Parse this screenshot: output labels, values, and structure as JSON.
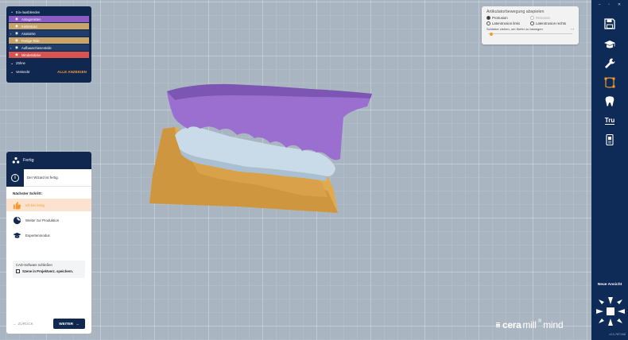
{
  "visibility_panel": {
    "header": "Ein-/ausblenden",
    "rows": [
      {
        "label": "Antagonisten",
        "color": "#8a5cc4",
        "arrow": false
      },
      {
        "label": "Kieferscan",
        "color": "#c9a56a",
        "arrow": false
      },
      {
        "label": "Anatomie",
        "color": "#1f3d6b",
        "arrow": true
      },
      {
        "label": "Fertige Teile",
        "color": "#c9a56a",
        "arrow": false
      },
      {
        "label": "Aufbauschienenteile",
        "color": "#1f3d6b",
        "arrow": true
      },
      {
        "label": "Mindestdicke",
        "color": "#d9534f",
        "arrow": false
      }
    ],
    "teeth_label": "Zähne",
    "hidden_label": "Versteckt",
    "show_all_label": "ALLE ANZEIGEN"
  },
  "articulator": {
    "title": "Artikulatorbewegung abspielen",
    "options": [
      {
        "label": "Protrusion",
        "checked": true,
        "disabled": false
      },
      {
        "label": "Retrusion",
        "checked": false,
        "disabled": true
      },
      {
        "label": "Laterotrusion links",
        "checked": false,
        "disabled": false
      },
      {
        "label": "Laterotrusion rechts",
        "checked": false,
        "disabled": false
      }
    ],
    "hint": "Schieber ziehen, um Kiefer zu bewegen",
    "nav": "‹ ›",
    "slider_value": 0
  },
  "toolbar": {
    "window_buttons": [
      "–",
      "▫",
      "✕"
    ],
    "icons": [
      "save-icon",
      "graduation-cap-icon",
      "wrench-icon",
      "spline-icon",
      "tooth-icon",
      "tru-icon",
      "scan-icon"
    ],
    "tru_label": "Tru",
    "new_view_label": "Neue Ansicht",
    "version": "v3.0-7871/68"
  },
  "wizard": {
    "title": "Fertig",
    "info": "Der Wizard ist fertig.",
    "next_step_label": "Nächster Schritt:",
    "steps": [
      {
        "label": "Ich bin fertig",
        "icon": "thumbs-up-icon",
        "active": true
      },
      {
        "label": "Weiter zur Produktion",
        "icon": "production-icon",
        "active": false
      },
      {
        "label": "Expertenmodus",
        "icon": "graduation-cap-icon",
        "active": false
      }
    ],
    "cad_close_label": "CAD-Software schließen",
    "save_scene_label": "Szene in Projektverz. speichern.",
    "back_label": "ZURÜCK",
    "next_label": "WEITER"
  },
  "logo": {
    "part1": "cera",
    "part2": "mill",
    "part3": "mind",
    "mark": "®"
  },
  "colors": {
    "upper_jaw": "#9a6fd0",
    "lower_gum": "#e1aa4f",
    "splint": "#c9dbe9",
    "navy": "#10284f",
    "accent": "#f39a2b"
  }
}
